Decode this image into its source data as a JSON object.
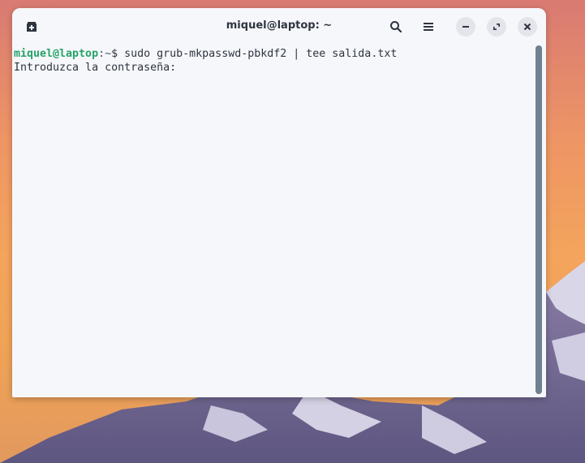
{
  "window": {
    "title": "miquel@laptop: ~"
  },
  "toolbar": {
    "new_tab_icon": "new-tab-icon",
    "search_icon": "search-icon",
    "menu_icon": "hamburger-menu-icon",
    "minimize_icon": "minimize-icon",
    "maximize_icon": "maximize-icon",
    "close_icon": "close-icon"
  },
  "terminal": {
    "prompt_user": "miquel@laptop",
    "prompt_path": ":~",
    "prompt_symbol": "$ ",
    "command": "sudo grub-mkpasswd-pbkdf2 | tee salida.txt",
    "output_line": "Introduzca la contraseña:"
  },
  "colors": {
    "prompt_user": "#26a269",
    "terminal_bg": "#f6f7fa",
    "scrollbar": "#6f8090"
  }
}
